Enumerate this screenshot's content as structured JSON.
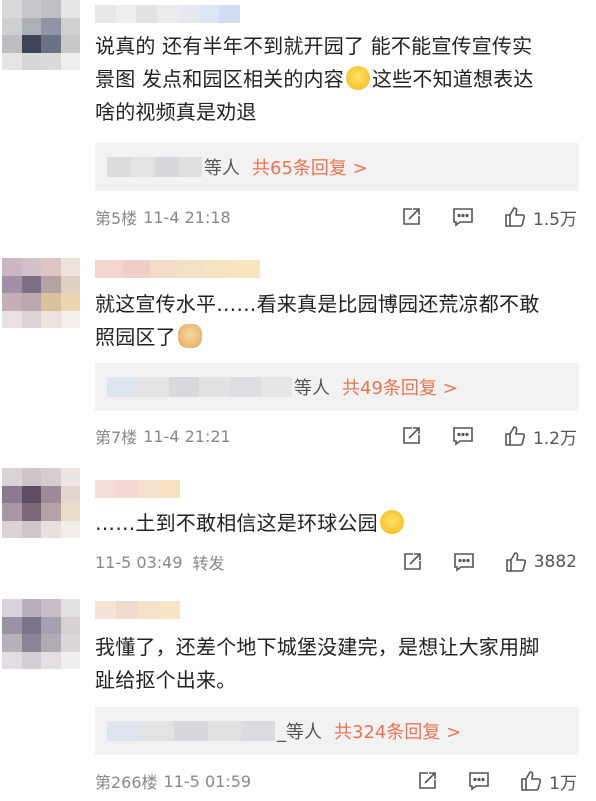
{
  "comments": [
    {
      "text_line1": "说真的 还有半年不到就开园了 能不能宣传宣传实",
      "text_line2": "景图 发点和园区相关的内容",
      "text_line2_tail": "这些不知道想表达",
      "text_line3": "啥的视频真是劝退",
      "emoji_icon": "laughing-tears-icon",
      "reply_suffix": "等人",
      "reply_count": "共65条回复 >",
      "floor": "第5楼",
      "time": "11-4 21:18",
      "likes": "1.5万"
    },
    {
      "text_line1": "就这宣传水平……看来真是比园博园还荒凉都不敢",
      "text_line2": "照园区了",
      "emoji_icon": "doge-icon",
      "reply_suffix": "等人",
      "reply_count": "共49条回复 >",
      "floor": "第7楼",
      "time": "11-4 21:21",
      "likes": "1.2万"
    },
    {
      "text_line1": "……土到不敢相信这是环球公园",
      "emoji_icon": "shy-face-icon",
      "time": "11-5 03:49",
      "forward": "转发",
      "likes": "3882"
    },
    {
      "text_line1": "我懂了，还差个地下城堡没建完，是想让大家用脚",
      "text_line2": "趾给抠个出来。",
      "reply_suffix": "_等人",
      "reply_count": "共324条回复 >",
      "floor": "第266楼",
      "time": "11-5 01:59",
      "likes": "1万"
    }
  ],
  "icons": {
    "share": "share-icon",
    "comment": "comment-icon",
    "like": "thumbs-up-icon"
  },
  "colors": {
    "accent": "#eb7350",
    "reply_bg": "#f2f2f2",
    "meta_text": "#888888"
  }
}
